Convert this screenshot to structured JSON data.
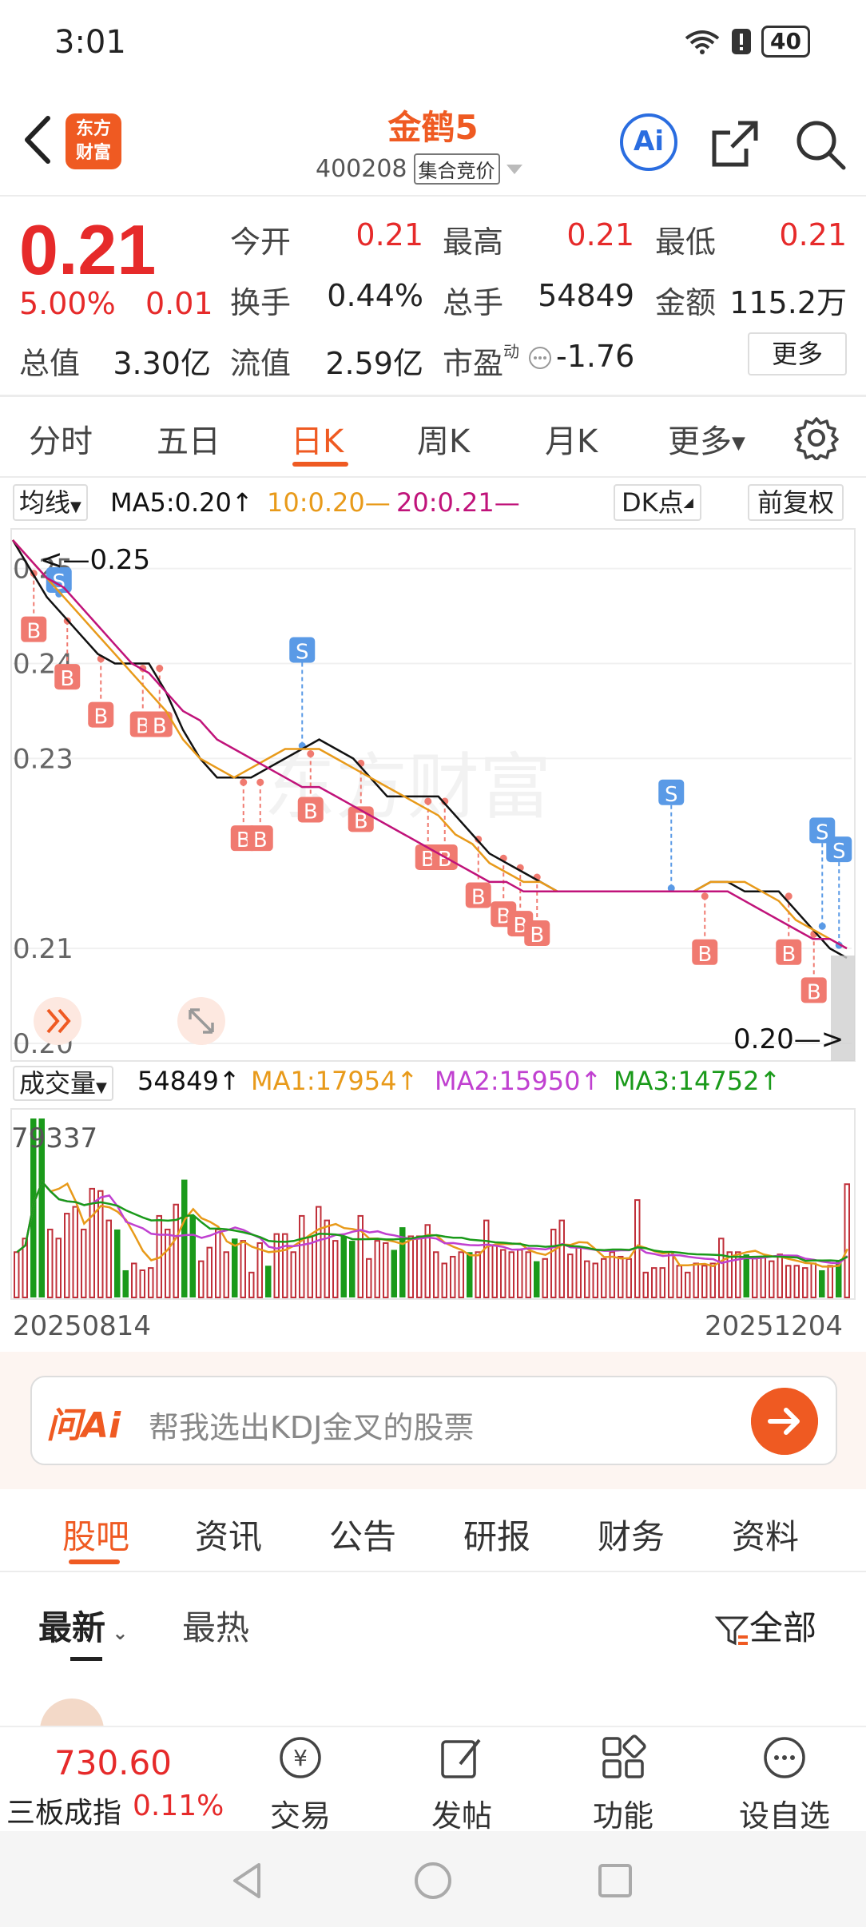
{
  "status": {
    "time": "3:01",
    "battery": "40"
  },
  "header": {
    "logo": "东方财富",
    "name": "金鹤5",
    "code": "400208",
    "mode": "集合竞价",
    "ai_label": "Ai"
  },
  "quote": {
    "price": "0.21",
    "pct": "5.00%",
    "change": "0.01",
    "fields": [
      {
        "label": "今开",
        "value": "0.21"
      },
      {
        "label": "最高",
        "value": "0.21"
      },
      {
        "label": "最低",
        "value": "0.21"
      },
      {
        "label": "换手",
        "value": "0.44%"
      },
      {
        "label": "总手",
        "value": "54849"
      },
      {
        "label": "金额",
        "value": "115.2万"
      },
      {
        "label": "总值",
        "value": "3.30亿"
      },
      {
        "label": "流值",
        "value": "2.59亿"
      },
      {
        "label": "市盈",
        "value": "-1.76",
        "sup": "动"
      }
    ],
    "more": "更多"
  },
  "period_tabs": [
    "分时",
    "五日",
    "日K",
    "周K",
    "月K",
    "更多"
  ],
  "active_period": "日K",
  "chart_header": {
    "selector": "均线",
    "ma5": "MA5:0.20↑",
    "ma10": "10:0.20—",
    "ma20": "20:0.21—",
    "dk": "DK点",
    "adjust": "前复权"
  },
  "colors": {
    "accent": "#ef5a22",
    "up": "#e62a2a",
    "down": "#1a9a1a",
    "ma5": "#111111",
    "ma10": "#e89a1a",
    "ma20": "#c0137a",
    "buy": "#f07a70",
    "sell": "#5a9ae6"
  },
  "chart_data": {
    "type": "line",
    "y_ticks": [
      "0.25",
      "0.24",
      "0.23",
      "0.21",
      "0.20"
    ],
    "ylim": [
      0.2,
      0.253
    ],
    "series": [
      {
        "name": "MA5",
        "values": [
          0.253,
          0.25,
          0.247,
          0.245,
          0.243,
          0.241,
          0.24,
          0.24,
          0.24,
          0.237,
          0.233,
          0.23,
          0.228,
          0.228,
          0.228,
          0.229,
          0.23,
          0.231,
          0.232,
          0.231,
          0.23,
          0.228,
          0.226,
          0.226,
          0.226,
          0.226,
          0.224,
          0.222,
          0.22,
          0.219,
          0.218,
          0.217,
          0.216,
          0.216,
          0.216,
          0.216,
          0.216,
          0.216,
          0.216,
          0.216,
          0.216,
          0.217,
          0.217,
          0.216,
          0.216,
          0.216,
          0.214,
          0.212,
          0.21,
          0.209
        ]
      },
      {
        "name": "MA10",
        "values": [
          0.253,
          0.251,
          0.249,
          0.247,
          0.245,
          0.243,
          0.241,
          0.239,
          0.237,
          0.235,
          0.232,
          0.23,
          0.229,
          0.228,
          0.229,
          0.23,
          0.231,
          0.231,
          0.231,
          0.23,
          0.229,
          0.228,
          0.227,
          0.226,
          0.225,
          0.224,
          0.222,
          0.221,
          0.219,
          0.218,
          0.217,
          0.217,
          0.216,
          0.216,
          0.216,
          0.216,
          0.216,
          0.216,
          0.216,
          0.216,
          0.216,
          0.217,
          0.217,
          0.217,
          0.216,
          0.215,
          0.213,
          0.212,
          0.211,
          0.21
        ]
      },
      {
        "name": "MA20",
        "values": [
          0.253,
          0.251,
          0.249,
          0.248,
          0.246,
          0.244,
          0.242,
          0.24,
          0.239,
          0.237,
          0.235,
          0.234,
          0.232,
          0.231,
          0.23,
          0.229,
          0.228,
          0.227,
          0.227,
          0.226,
          0.225,
          0.224,
          0.223,
          0.222,
          0.221,
          0.22,
          0.219,
          0.218,
          0.217,
          0.217,
          0.216,
          0.216,
          0.216,
          0.216,
          0.216,
          0.216,
          0.216,
          0.216,
          0.216,
          0.216,
          0.216,
          0.216,
          0.216,
          0.215,
          0.214,
          0.213,
          0.212,
          0.211,
          0.211,
          0.21
        ]
      }
    ],
    "annotations": {
      "high": "0.25",
      "low": "0.20",
      "buy_label": "B",
      "sell_label": "S",
      "buy_points": [
        2,
        6,
        10,
        15,
        17,
        27,
        29,
        35,
        41,
        49,
        51,
        55,
        58,
        60,
        62,
        82,
        92,
        95
      ],
      "sell_points": [
        5,
        34,
        78,
        96,
        98
      ]
    },
    "volume": {
      "selector": "成交量",
      "current": "54849↑",
      "ma1": "MA1:17954↑",
      "ma2": "MA2:15950↑",
      "ma3": "MA3:14752↑",
      "max_label": "79337",
      "start_date": "20250814",
      "end_date": "20251204",
      "values": [
        20,
        26,
        79,
        79,
        30,
        26,
        37,
        40,
        30,
        48,
        47,
        34,
        30,
        12,
        15,
        12,
        13,
        36,
        30,
        41,
        52,
        36,
        16,
        22,
        30,
        20,
        26,
        25,
        11,
        24,
        14,
        28,
        28,
        20,
        36,
        27,
        40,
        34,
        25,
        27,
        25,
        36,
        17,
        25,
        24,
        21,
        31,
        27,
        27,
        32,
        20,
        15,
        18,
        20,
        20,
        20,
        34,
        23,
        21,
        20,
        21,
        20,
        16,
        17,
        30,
        34,
        19,
        22,
        16,
        15,
        17,
        20,
        18,
        17,
        43,
        11,
        13,
        13,
        20,
        14,
        11,
        15,
        14,
        15,
        26,
        20,
        20,
        19,
        18,
        18,
        16,
        19,
        14,
        14,
        13,
        15,
        12,
        14,
        16,
        50
      ],
      "down_days": [
        2,
        3,
        12,
        13,
        20,
        21,
        26,
        30,
        39,
        40,
        45,
        46,
        54,
        62,
        87,
        96,
        98
      ]
    }
  },
  "ask_ai": {
    "logo": "问Ai",
    "placeholder": "帮我选出KDJ金叉的股票"
  },
  "content_tabs": [
    "股吧",
    "资讯",
    "公告",
    "研报",
    "财务",
    "资料"
  ],
  "sub_tabs": {
    "latest": "最新",
    "hot": "最热",
    "filter": "全部"
  },
  "bottom": {
    "index_value": "730.60",
    "index_name": "三板成指",
    "index_pct": "0.11%",
    "items": [
      "交易",
      "发帖",
      "功能",
      "设自选"
    ]
  }
}
